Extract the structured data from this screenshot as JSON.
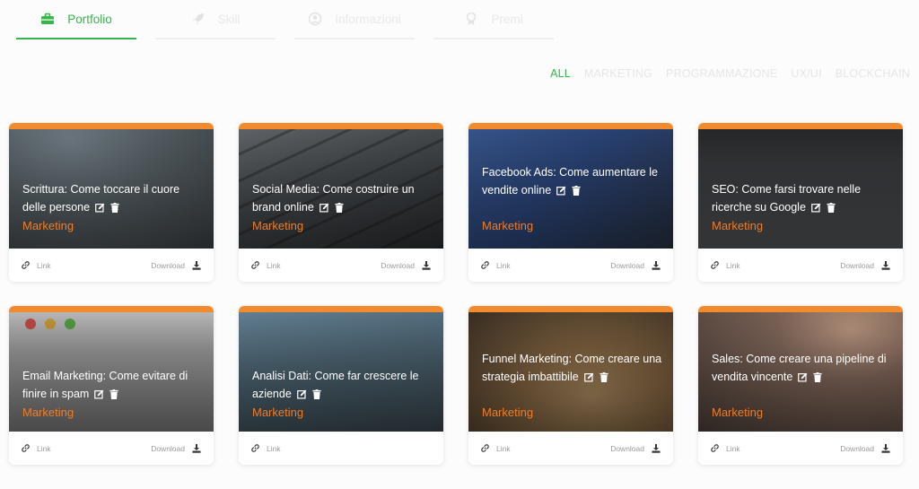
{
  "tabs": [
    {
      "label": "Portfolio",
      "icon": "briefcase-icon",
      "active": true
    },
    {
      "label": "Skill",
      "icon": "rocket-icon",
      "active": false
    },
    {
      "label": "Informazioni",
      "icon": "user-circle-icon",
      "active": false
    },
    {
      "label": "Premi",
      "icon": "award-icon",
      "active": false
    }
  ],
  "filters": [
    "ALL",
    "MARKETING",
    "PROGRAMMAZIONE",
    "UX/UI",
    "BLOCKCHAIN"
  ],
  "colors": {
    "accent": "#35b54a",
    "orange": "#f28a2e",
    "category": "#f07d26"
  },
  "cards": [
    {
      "title": "Scrittura: Come toccare il cuore delle persone",
      "category": "Marketing",
      "link": "Link",
      "download": "Download"
    },
    {
      "title": "Social Media: Come costruire un brand online",
      "category": "Marketing",
      "link": "Link",
      "download": "Download"
    },
    {
      "title": "Facebook Ads: Come aumentare le vendite online",
      "category": "Marketing",
      "link": "Link",
      "download": "Download"
    },
    {
      "title": "SEO: Come farsi trovare nelle ricerche su Google",
      "category": "Marketing",
      "link": "Link",
      "download": "Download"
    },
    {
      "title": "Email Marketing: Come evitare di finire in spam",
      "category": "Marketing",
      "link": "Link",
      "download": "Download"
    },
    {
      "title": "Analisi Dati: Come far crescere le aziende",
      "category": "Marketing",
      "link": "Link",
      "download": ""
    },
    {
      "title": "Funnel Marketing: Come creare una strategia imbattibile",
      "category": "Marketing",
      "link": "Link",
      "download": "Download"
    },
    {
      "title": "Sales: Come creare una pipeline di vendita vincente",
      "category": "Marketing",
      "link": "Link",
      "download": "Download"
    }
  ]
}
